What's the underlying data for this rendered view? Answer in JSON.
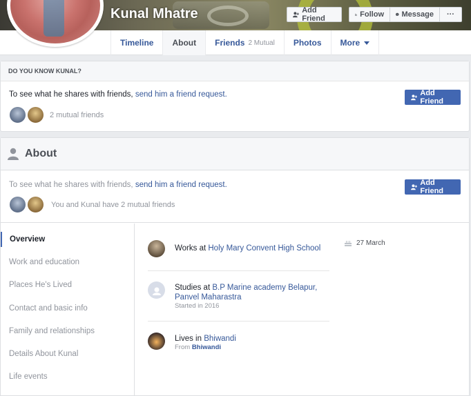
{
  "profile": {
    "name": "Kunal Mhatre"
  },
  "header_actions": {
    "add_friend": "Add Friend",
    "follow": "Follow",
    "message": "Message",
    "more": "···"
  },
  "tabs": [
    {
      "label": "Timeline"
    },
    {
      "label": "About"
    },
    {
      "label": "Friends",
      "sub": "2 Mutual"
    },
    {
      "label": "Photos"
    },
    {
      "label": "More"
    }
  ],
  "know_card": {
    "heading": "DO YOU KNOW KUNAL?",
    "prompt_text": "To see what he shares with friends,",
    "prompt_link": "send him a friend request.",
    "mutual_text": "2 mutual friends",
    "button_label": "Add Friend"
  },
  "about": {
    "title": "About",
    "prompt_text": "To see what he shares with friends,",
    "prompt_link": "send him a friend request.",
    "mutual_text": "You and Kunal have 2 mutual friends",
    "button_label": "Add Friend",
    "menu": [
      "Overview",
      "Work and education",
      "Places He's Lived",
      "Contact and basic info",
      "Family and relationships",
      "Details About Kunal",
      "Life events"
    ],
    "work": {
      "prefix": "Works at",
      "place": "Holy Mary Convent High School"
    },
    "education": {
      "prefix": "Studies at",
      "place": "B.P Marine academy Belapur, Panvel Maharastra",
      "meta": "Started in 2016"
    },
    "lives": {
      "prefix": "Lives in",
      "place": "Bhiwandi",
      "from_label": "From",
      "from_place": "Bhiwandi"
    },
    "birthday": "27 March"
  },
  "colors": {
    "brand": "#4267b2",
    "link": "#365899"
  }
}
